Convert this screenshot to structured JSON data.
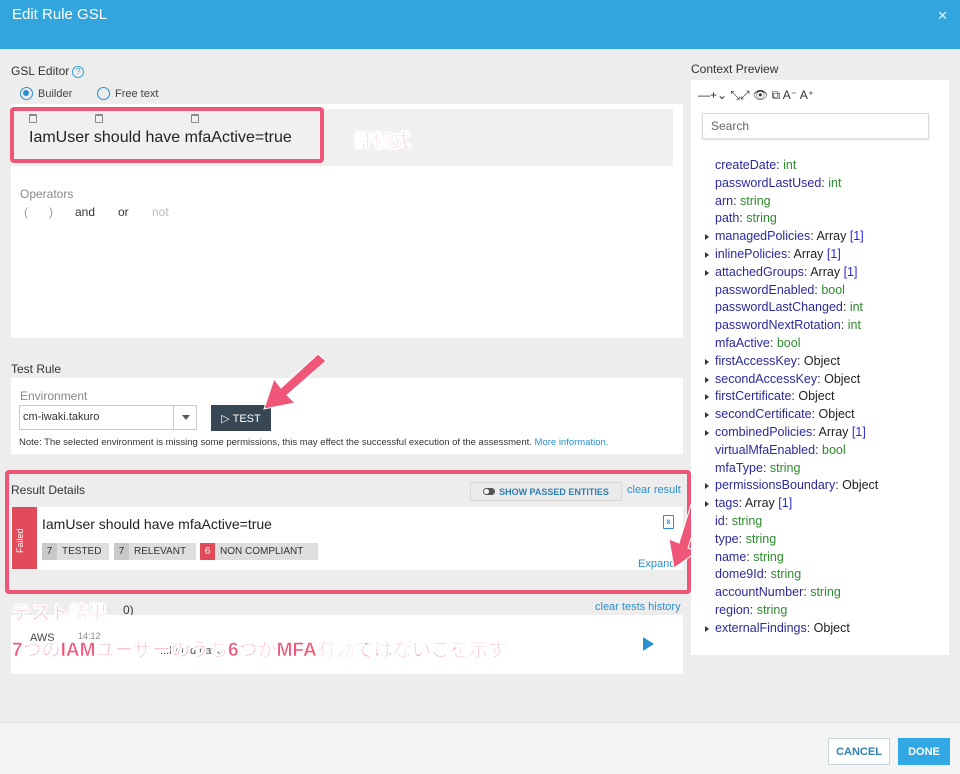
{
  "window": {
    "title": "Edit Rule GSL",
    "close_label": "✕"
  },
  "editor": {
    "heading": "GSL Editor",
    "help_glyph": "?",
    "mode_builder": "Builder",
    "mode_free_text": "Free text",
    "expression": "IamUser should have mfaActive=true",
    "operators_label": "Operators",
    "operators": [
      "(",
      ")",
      "and",
      "or",
      "not"
    ]
  },
  "test_rule": {
    "heading": "Test Rule",
    "environment_label": "Environment",
    "environment_value": "cm-iwaki.takuro",
    "test_button": "TEST",
    "note": "Note: The selected environment is missing some permissions, this may effect the successful execution of the assessment.",
    "note_link": "More information."
  },
  "result": {
    "heading": "Result Details",
    "show_passed": "SHOW PASSED ENTITIES",
    "clear_result": "clear result",
    "status": "Failed",
    "title": "IamUser should have mfaActive=true",
    "stats": [
      {
        "count": "7",
        "label": "TESTED"
      },
      {
        "count": "7",
        "label": "RELEVANT"
      },
      {
        "count": "6",
        "label": "NON COMPLIANT"
      }
    ],
    "expand": "Expand",
    "export_icon_glyph": "x"
  },
  "history": {
    "heading_fragment": "0)",
    "clear_history": "clear tests history",
    "row_fragment": "AWS",
    "row_fragment_2": "...hould have",
    "row_time": "14:12"
  },
  "context_preview": {
    "heading": "Context Preview",
    "toolbar_glyphs": "—+⌄  ⤡⤢ 👁 ⧉  A⁻ A⁺",
    "search_placeholder": "Search",
    "fields": [
      {
        "key": "createDate",
        "type": "int",
        "kind": "t"
      },
      {
        "key": "passwordLastUsed",
        "type": "int",
        "kind": "t"
      },
      {
        "key": "arn",
        "type": "string",
        "kind": "t"
      },
      {
        "key": "path",
        "type": "string",
        "kind": "t"
      },
      {
        "key": "managedPolicies",
        "type": "Array",
        "count": "[1]",
        "kind": "o"
      },
      {
        "key": "inlinePolicies",
        "type": "Array",
        "count": "[1]",
        "kind": "o"
      },
      {
        "key": "attachedGroups",
        "type": "Array",
        "count": "[1]",
        "kind": "o"
      },
      {
        "key": "passwordEnabled",
        "type": "bool",
        "kind": "t"
      },
      {
        "key": "passwordLastChanged",
        "type": "int",
        "kind": "t"
      },
      {
        "key": "passwordNextRotation",
        "type": "int",
        "kind": "t"
      },
      {
        "key": "mfaActive",
        "type": "bool",
        "kind": "t"
      },
      {
        "key": "firstAccessKey",
        "type": "Object",
        "kind": "o"
      },
      {
        "key": "secondAccessKey",
        "type": "Object",
        "kind": "o"
      },
      {
        "key": "firstCertificate",
        "type": "Object",
        "kind": "o"
      },
      {
        "key": "secondCertificate",
        "type": "Object",
        "kind": "o"
      },
      {
        "key": "combinedPolicies",
        "type": "Array",
        "count": "[1]",
        "kind": "o"
      },
      {
        "key": "virtualMfaEnabled",
        "type": "bool",
        "kind": "t"
      },
      {
        "key": "mfaType",
        "type": "string",
        "kind": "t"
      },
      {
        "key": "permissionsBoundary",
        "type": "Object",
        "kind": "o"
      },
      {
        "key": "tags",
        "type": "Array",
        "count": "[1]",
        "kind": "o"
      },
      {
        "key": "id",
        "type": "string",
        "kind": "t"
      },
      {
        "key": "type",
        "type": "string",
        "kind": "t"
      },
      {
        "key": "name",
        "type": "string",
        "kind": "t"
      },
      {
        "key": "dome9Id",
        "type": "string",
        "kind": "t"
      },
      {
        "key": "accountNumber",
        "type": "string",
        "kind": "t"
      },
      {
        "key": "region",
        "type": "string",
        "kind": "t"
      },
      {
        "key": "externalFindings",
        "type": "Object",
        "kind": "o"
      }
    ]
  },
  "footer": {
    "cancel": "CANCEL",
    "done": "DONE"
  },
  "annotations": {
    "expression_note": "評価式",
    "result_title": "テスト結果",
    "result_note": "7つのIAMユーザーのうち6つがMFA有効ではないこを示す"
  },
  "colors": {
    "accent": "#33a5dd",
    "failed": "#e24a59",
    "annotation": "#f05677"
  }
}
